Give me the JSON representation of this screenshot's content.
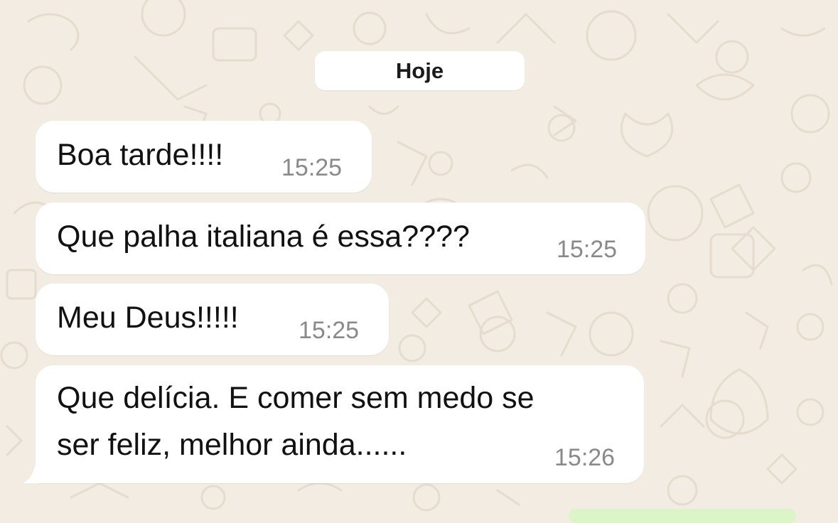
{
  "date_separator": "Hoje",
  "messages": [
    {
      "text": "Boa tarde!!!!",
      "time": "15:25"
    },
    {
      "text": "Que palha italiana é essa????",
      "time": "15:25"
    },
    {
      "text": "Meu Deus!!!!!",
      "time": "15:25"
    },
    {
      "text_line1": "Que delícia. E comer sem medo se",
      "text_line2": "ser feliz, melhor ainda......",
      "time": "15:26"
    }
  ],
  "colors": {
    "wallpaper": "#f3ece2",
    "incoming_bubble": "#ffffff",
    "outgoing_bubble": "#dbf4c8",
    "time_text": "#8a8a8a"
  }
}
